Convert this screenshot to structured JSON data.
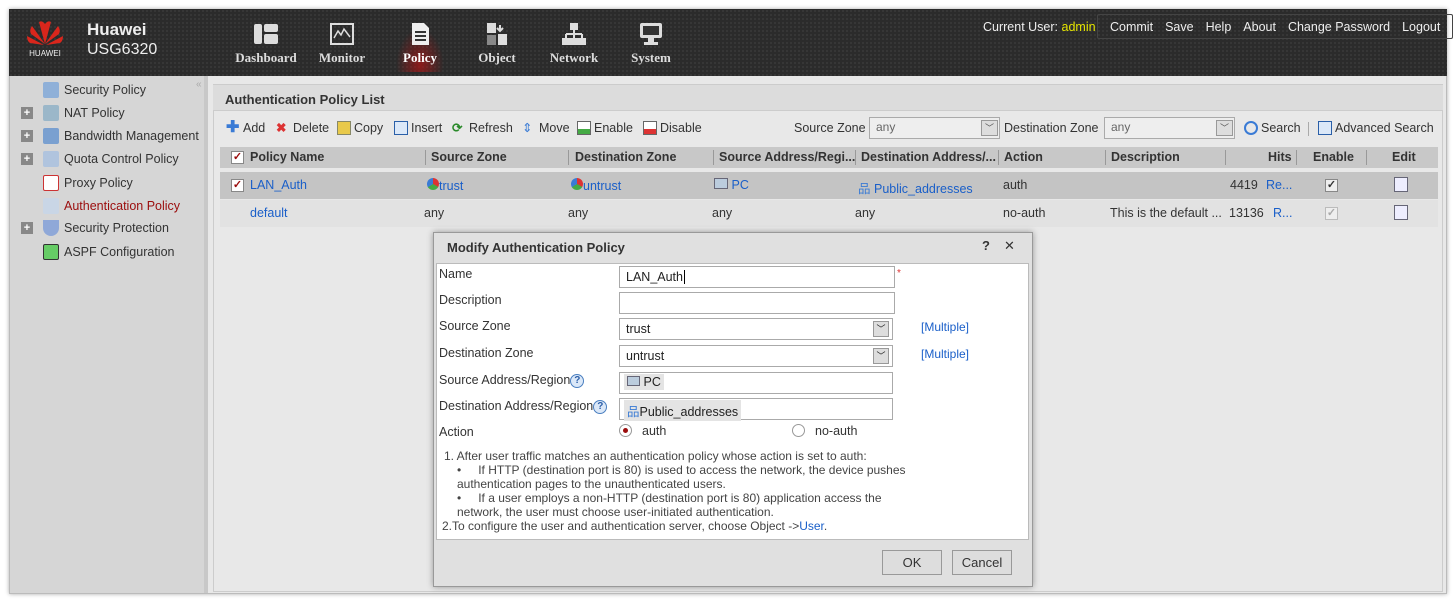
{
  "header": {
    "brand": "Huawei",
    "model": "USG6320",
    "logo_text": "HUAWEI",
    "nav": [
      {
        "label": "Dashboard",
        "icon": "dashboard-icon"
      },
      {
        "label": "Monitor",
        "icon": "monitor-icon"
      },
      {
        "label": "Policy",
        "icon": "policy-icon",
        "active": true
      },
      {
        "label": "Object",
        "icon": "object-icon"
      },
      {
        "label": "Network",
        "icon": "network-icon"
      },
      {
        "label": "System",
        "icon": "system-icon"
      }
    ],
    "current_user_label": "Current User:",
    "current_user": "admin",
    "links": [
      "Commit",
      "Save",
      "Help",
      "About",
      "Change Password",
      "Logout"
    ]
  },
  "sidebar": {
    "items": [
      {
        "label": "Security Policy",
        "expandable": false
      },
      {
        "label": "NAT Policy",
        "expandable": true
      },
      {
        "label": "Bandwidth Management",
        "expandable": true
      },
      {
        "label": "Quota Control Policy",
        "expandable": true
      },
      {
        "label": "Proxy Policy",
        "expandable": false
      },
      {
        "label": "Authentication Policy",
        "expandable": false,
        "active": true
      },
      {
        "label": "Security Protection",
        "expandable": true
      },
      {
        "label": "ASPF Configuration",
        "expandable": false
      }
    ]
  },
  "main": {
    "title": "Authentication Policy List",
    "toolbar": {
      "add": "Add",
      "delete": "Delete",
      "copy": "Copy",
      "insert": "Insert",
      "refresh": "Refresh",
      "move": "Move",
      "enable": "Enable",
      "disable": "Disable",
      "source_zone_label": "Source Zone",
      "source_zone_value": "any",
      "dest_zone_label": "Destination Zone",
      "dest_zone_value": "any",
      "search": "Search",
      "advanced_search": "Advanced Search"
    },
    "columns": [
      "Policy Name",
      "Source Zone",
      "Destination Zone",
      "Source Address/Regi...",
      "Destination Address/...",
      "Action",
      "Description",
      "Hits",
      "Enable",
      "Edit"
    ],
    "rows": [
      {
        "name": "LAN_Auth",
        "source_zone": "trust",
        "dest_zone": "untrust",
        "source_addr": "PC",
        "dest_addr": "Public_addresses",
        "action": "auth",
        "description": "",
        "hits": "4419",
        "reset": "Re...",
        "enabled": true,
        "selected": true
      },
      {
        "name": "default",
        "source_zone": "any",
        "dest_zone": "any",
        "source_addr": "any",
        "dest_addr": "any",
        "action": "no-auth",
        "description": "This is the default ...",
        "hits": "13136",
        "reset": "R...",
        "enabled": true,
        "selected": false
      }
    ]
  },
  "dialog": {
    "title": "Modify Authentication Policy",
    "help": "?",
    "close": "✕",
    "fields": {
      "name_label": "Name",
      "name_value": "LAN_Auth",
      "required": "*",
      "description_label": "Description",
      "description_value": "",
      "source_zone_label": "Source Zone",
      "source_zone_value": "trust",
      "dest_zone_label": "Destination Zone",
      "dest_zone_value": "untrust",
      "multiple": "[Multiple]",
      "source_addr_label": "Source Address/Region",
      "source_addr_value": "PC",
      "dest_addr_label": "Destination Address/Region",
      "dest_addr_value": "Public_addresses",
      "action_label": "Action",
      "action_auth": "auth",
      "action_noauth": "no-auth",
      "action_selected": "auth"
    },
    "notes": {
      "line1": "1. After user traffic matches an authentication policy whose action is set to auth:",
      "bullet1a": "If HTTP (destination port is 80) is used to access the network, the device pushes",
      "bullet1b": "authentication pages to the unauthenticated users.",
      "bullet2a": "If a user employs a non-HTTP (destination port is 80) application access the",
      "bullet2b": "network, the user must choose user-initiated authentication.",
      "line2": "2.To configure the user and authentication server, choose Object ->",
      "line2_link": "User",
      "line2_end": "."
    },
    "ok": "OK",
    "cancel": "Cancel"
  },
  "colors": {
    "accent_red": "#9b0d0d",
    "link": "#1a5fc9",
    "admin": "#e5e500",
    "header_bg": "#2b2b2b"
  }
}
